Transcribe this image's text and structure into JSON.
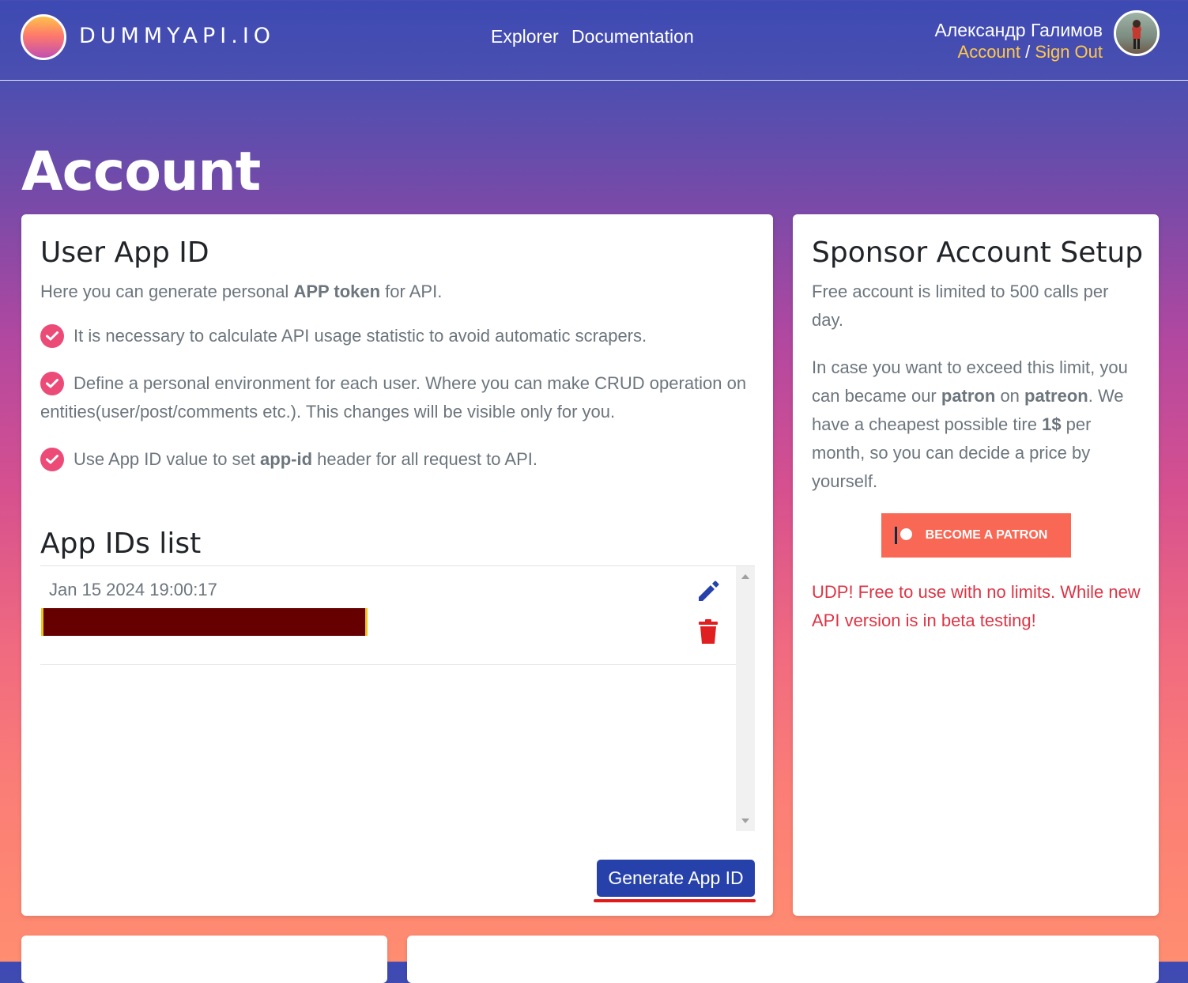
{
  "header": {
    "logo_text": "DUMMYAPI.IO",
    "nav": [
      "Explorer",
      "Documentation"
    ],
    "user_name": "Александр Галимов",
    "account_link": "Account",
    "separator": "/",
    "signout_link": "Sign Out"
  },
  "page": {
    "title": "Account"
  },
  "user_app_id": {
    "title": "User App ID",
    "intro_prefix": "Here you can generate personal ",
    "intro_bold": "APP token",
    "intro_suffix": " for API.",
    "bullets": [
      {
        "text": "It is necessary to calculate API usage statistic to avoid automatic scrapers."
      },
      {
        "text": "Define a personal environment for each user. Where you can make CRUD operation on entities(user/post/comments etc.). This changes will be visible only for you."
      },
      {
        "prefix": "Use App ID value to set ",
        "bold": "app-id",
        "suffix": " header for all request to API."
      }
    ],
    "list_title": "App IDs list",
    "items": [
      {
        "date": "Jan 15 2024 19:00:17"
      }
    ],
    "generate_button": "Generate App ID"
  },
  "sponsor": {
    "title": "Sponsor Account Setup",
    "p1": "Free account is limited to 500 calls per day.",
    "p2_a": "In case you want to exceed this limit, you can became our ",
    "p2_bold1": "patron",
    "p2_b": " on ",
    "p2_bold2": "patreon",
    "p2_c": ". We have a cheapest possible tire ",
    "p2_bold3": "1$",
    "p2_d": " per month, so you can decide a price by yourself.",
    "patron_button": "BECOME A PATRON",
    "udp": "UDP! Free to use with no limits. While new API version is in beta testing!"
  },
  "colors": {
    "primary_button": "#2741ab",
    "accent_link": "#ffc84a",
    "check": "#ec4b78",
    "patreon": "#f96854",
    "alert": "#dc3545"
  },
  "icons": [
    "logo-icon",
    "avatar",
    "check-icon",
    "edit-icon",
    "trash-icon",
    "patreon-icon"
  ]
}
